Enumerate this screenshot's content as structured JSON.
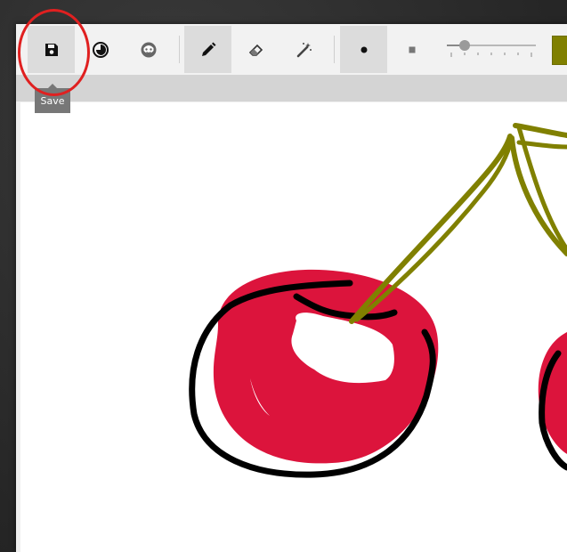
{
  "toolbar": {
    "tools": [
      {
        "id": "save",
        "icon": "floppy-disk-icon",
        "active": true
      },
      {
        "id": "invert",
        "icon": "contrast-circle-icon",
        "active": false
      },
      {
        "id": "face",
        "icon": "smiley-icon",
        "active": false
      },
      {
        "id": "pencil",
        "icon": "pencil-icon",
        "active": true
      },
      {
        "id": "eraser",
        "icon": "eraser-icon",
        "active": false
      },
      {
        "id": "magic",
        "icon": "magic-wand-icon",
        "active": false
      },
      {
        "id": "brush-round",
        "icon": "round-brush-icon",
        "active": true
      },
      {
        "id": "brush-square",
        "icon": "square-brush-icon",
        "active": false
      }
    ],
    "brush_size_level": 0.2,
    "current_color": "#808000"
  },
  "tooltip": {
    "text": "Save"
  },
  "colors": {
    "cherry": "#dc143c",
    "outline": "#000000",
    "stem": "#808000",
    "highlight_circle": "#e02020"
  }
}
